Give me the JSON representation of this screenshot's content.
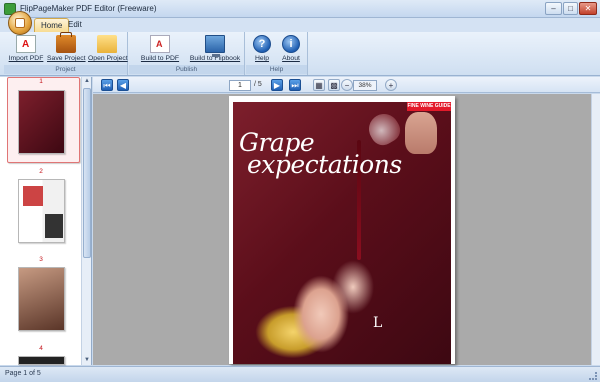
{
  "window": {
    "title": "FlipPageMaker PDF Editor (Freeware)",
    "buttons": [
      "–",
      "□",
      "✕"
    ]
  },
  "tabs": [
    {
      "label": "Home",
      "active": true
    },
    {
      "label": "Edit",
      "active": false
    }
  ],
  "ribbon": {
    "groups": [
      {
        "label": "Project",
        "buttons": [
          {
            "label": "Import PDF",
            "icon": "pdf-icon"
          },
          {
            "label": "Save Project",
            "icon": "briefcase-icon"
          },
          {
            "label": "Open Project",
            "icon": "folder-icon"
          }
        ]
      },
      {
        "label": "Publish",
        "buttons": [
          {
            "label": "Build to PDF",
            "icon": "pdf-build-icon"
          },
          {
            "label": "Build to Flipbook",
            "icon": "monitor-icon"
          }
        ]
      },
      {
        "label": "Help",
        "buttons": [
          {
            "label": "Help",
            "icon": "question-icon",
            "glyph": "?"
          },
          {
            "label": "About",
            "icon": "info-icon",
            "glyph": "i"
          }
        ]
      }
    ]
  },
  "thumbnails": [
    {
      "number": "1",
      "selected": true
    },
    {
      "number": "2",
      "selected": false
    },
    {
      "number": "3",
      "selected": false
    },
    {
      "number": "4",
      "selected": false
    }
  ],
  "viewer_toolbar": {
    "current_page": "1",
    "total_pages": "/ 5",
    "zoom": "38%"
  },
  "page_content": {
    "badge": "FINE WINE GUIDE",
    "headline_line1": "Grape",
    "headline_line2": "expectations",
    "dropcap": "L"
  },
  "status": {
    "text": "Page 1 of 5"
  },
  "colors": {
    "accent_selection": "#e07575",
    "badge_red": "#e31a2a",
    "ribbon_blue": "#cfdff1"
  }
}
